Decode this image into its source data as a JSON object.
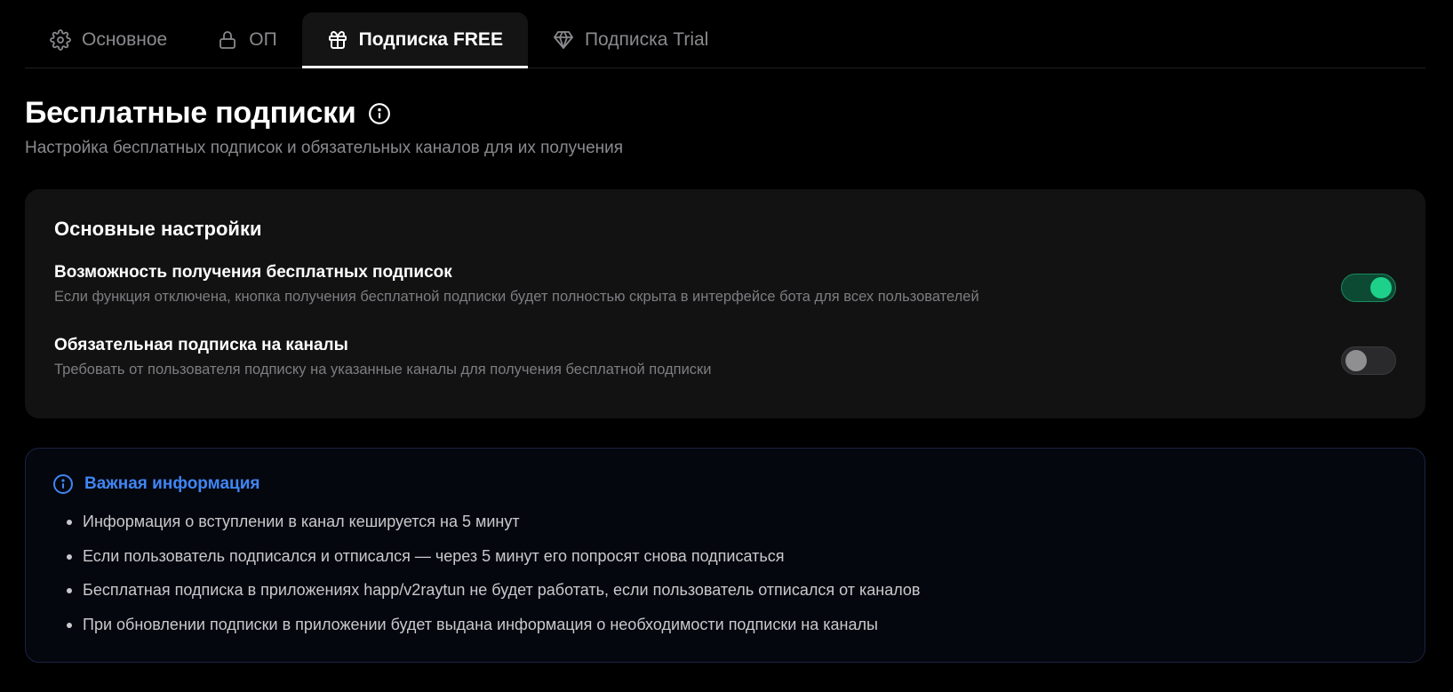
{
  "tabs": [
    {
      "label": "Основное",
      "icon": "gear-icon",
      "active": false
    },
    {
      "label": "ОП",
      "icon": "lock-icon",
      "active": false
    },
    {
      "label": "Подписка FREE",
      "icon": "gift-icon",
      "active": true
    },
    {
      "label": "Подписка Trial",
      "icon": "diamond-icon",
      "active": false
    }
  ],
  "header": {
    "title": "Бесплатные подписки",
    "subtitle": "Настройка бесплатных подписок и обязательных каналов для их получения"
  },
  "settings_card": {
    "title": "Основные настройки",
    "items": [
      {
        "label": "Возможность получения бесплатных подписок",
        "description": "Если функция отключена, кнопка получения бесплатной подписки будет полностью скрыта в интерфейсе бота для всех пользователей",
        "enabled": true
      },
      {
        "label": "Обязательная подписка на каналы",
        "description": "Требовать от пользователя подписку на указанные каналы для получения бесплатной подписки",
        "enabled": false
      }
    ]
  },
  "notice": {
    "title": "Важная информация",
    "items": [
      "Информация о вступлении в канал кешируется на 5 минут",
      "Если пользователь подписался и отписался — через 5 минут его попросят снова подписаться",
      "Бесплатная подписка в приложениях happ/v2raytun не будет работать, если пользователь отписался от каналов",
      "При обновлении подписки в приложении будет выдана информация о необходимости подписки на каналы"
    ]
  },
  "colors": {
    "background": "#000000",
    "card": "#121212",
    "accent_blue": "#3f86f5",
    "toggle_on": "#1ed18a",
    "muted_text": "#8a8a8e"
  }
}
